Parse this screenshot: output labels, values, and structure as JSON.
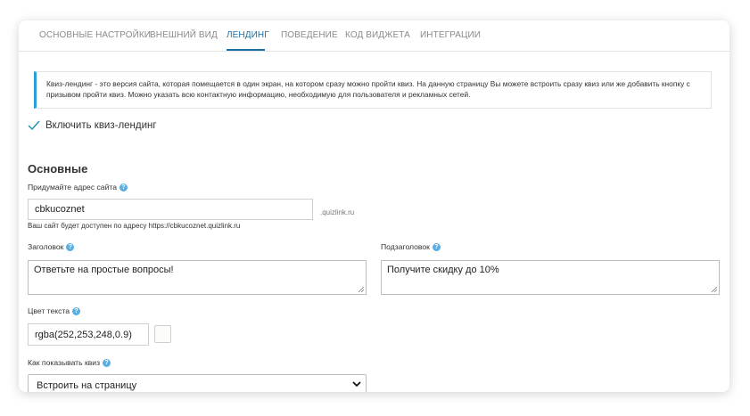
{
  "tabs": [
    {
      "label": "ОСНОВНЫЕ НАСТРОЙКИ"
    },
    {
      "label": "ВНЕШНИЙ ВИД"
    },
    {
      "label": "ЛЕНДИНГ"
    },
    {
      "label": "ПОВЕДЕНИЕ"
    },
    {
      "label": "КОД ВИДЖЕТА"
    },
    {
      "label": "ИНТЕГРАЦИИ"
    }
  ],
  "active_tab": "ЛЕНДИНГ",
  "info": {
    "text": "Квиз-лендинг - это версия сайта, которая помещается в один экран, на котором сразу можно пройти квиз. На данную страницу Вы можете встроить сразу квиз или же добавить кнопку с призывом пройти квиз. Можно указать всю контактную информацию, необходимую для пользователя и рекламных сетей."
  },
  "enable": {
    "label": "Включить квиз-лендинг",
    "checked": true
  },
  "section_title": "Основные",
  "address": {
    "label": "Придумайте адрес сайта",
    "value": "cbkucoznet",
    "suffix": ".quizlink.ru",
    "hint": "Ваш сайт будет доступен по адресу https://cbkucoznet.quizlink.ru"
  },
  "headline": {
    "label": "Заголовок",
    "value": "Ответьте на простые вопросы!"
  },
  "subheadline": {
    "label": "Подзаголовок",
    "value": "Получите скидку до 10%"
  },
  "text_color": {
    "label": "Цвет текста",
    "value": "rgba(252,253,248,0.9)"
  },
  "show_mode": {
    "label": "Как показывать квиз",
    "value": "Встроить на страницу"
  },
  "colors": {
    "accent": "#1d6fa3",
    "info_border": "#29a0d8",
    "help_icon": "#5aaee0"
  },
  "icons": {
    "check": "check-icon",
    "help": "question-circle-icon",
    "dropdown": "chevron-down-icon",
    "resize": "resize-grip-icon"
  }
}
